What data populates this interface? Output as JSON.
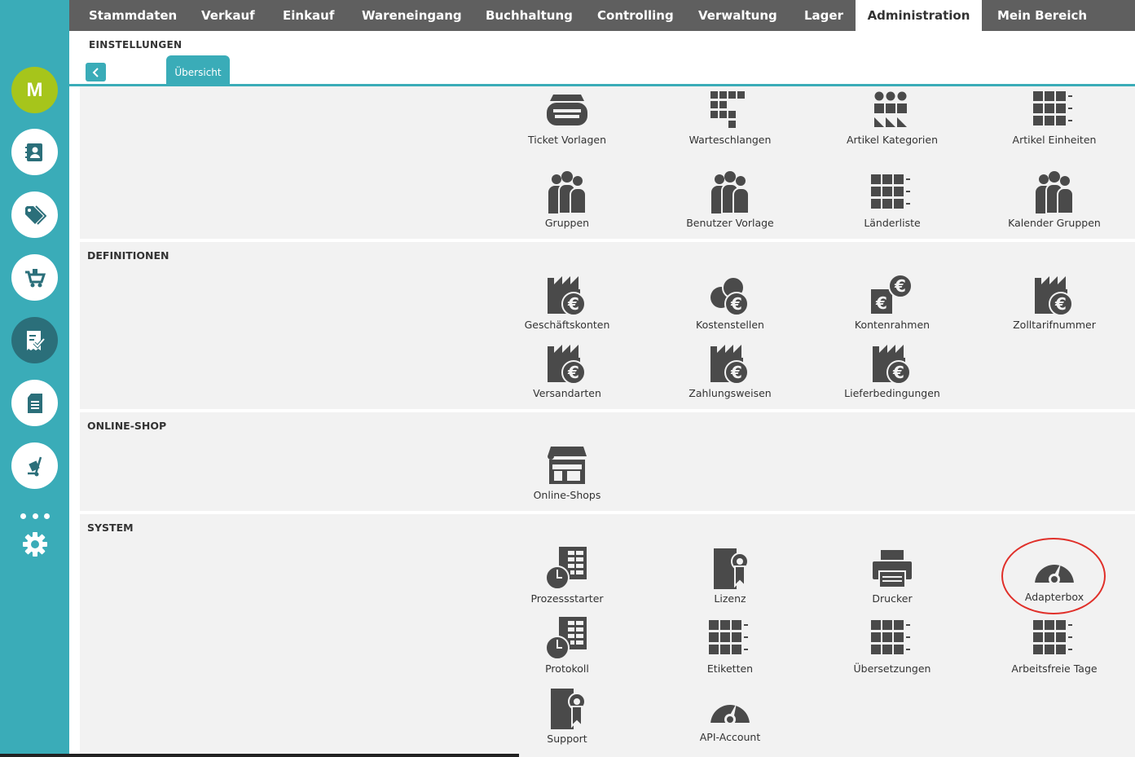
{
  "sidebar": {
    "avatar_letter": "M",
    "items": [
      {
        "icon": "contacts-icon"
      },
      {
        "icon": "tags-icon"
      },
      {
        "icon": "cart-icon"
      },
      {
        "icon": "receipt-check-icon"
      },
      {
        "icon": "document-icon"
      },
      {
        "icon": "hand-truck-icon"
      }
    ],
    "more_icon": "more-dots-icon",
    "settings_icon": "gear-icon"
  },
  "nav": {
    "items": [
      "Stammdaten",
      "Verkauf",
      "Einkauf",
      "Wareneingang",
      "Buchhaltung",
      "Controlling",
      "Verwaltung",
      "Lager",
      "Administration",
      "Mein Bereich"
    ],
    "active": "Administration"
  },
  "header": {
    "title": "EINSTELLUNGEN",
    "tab_overview": "Übersicht"
  },
  "sections": {
    "top": {
      "tiles": [
        {
          "label": "Ticket Vorlagen",
          "icon": "ticket-icon"
        },
        {
          "label": "Warteschlangen",
          "icon": "queue-icon"
        },
        {
          "label": "Artikel Kategorien",
          "icon": "categories-icon"
        },
        {
          "label": "Artikel Einheiten",
          "icon": "grid-list-icon"
        },
        {
          "label": "Gruppen",
          "icon": "group-icon"
        },
        {
          "label": "Benutzer Vorlage",
          "icon": "group-icon"
        },
        {
          "label": "Länderliste",
          "icon": "grid-list-icon"
        },
        {
          "label": "Kalender Gruppen",
          "icon": "group-icon"
        }
      ]
    },
    "definitionen": {
      "title": "DEFINITIONEN",
      "tiles": [
        {
          "label": "Geschäftskonten",
          "icon": "factory-euro-icon"
        },
        {
          "label": "Kostenstellen",
          "icon": "coins-euro-icon"
        },
        {
          "label": "Kontenrahmen",
          "icon": "euro-exchange-icon"
        },
        {
          "label": "Zolltarifnummer",
          "icon": "factory-euro-icon"
        },
        {
          "label": "Versandarten",
          "icon": "factory-euro-icon"
        },
        {
          "label": "Zahlungsweisen",
          "icon": "factory-euro-icon"
        },
        {
          "label": "Lieferbedingungen",
          "icon": "factory-euro-icon"
        }
      ]
    },
    "onlineshop": {
      "title": "ONLINE-SHOP",
      "tiles": [
        {
          "label": "Online-Shops",
          "icon": "shop-icon"
        }
      ]
    },
    "system": {
      "title": "SYSTEM",
      "tiles": [
        {
          "label": "Prozessstarter",
          "icon": "clock-sheet-icon"
        },
        {
          "label": "Lizenz",
          "icon": "license-icon"
        },
        {
          "label": "Drucker",
          "icon": "printer-icon"
        },
        {
          "label": "Adapterbox",
          "icon": "gauge-icon"
        },
        {
          "label": "Protokoll",
          "icon": "clock-sheet-icon"
        },
        {
          "label": "Etiketten",
          "icon": "grid-list-icon"
        },
        {
          "label": "Übersetzungen",
          "icon": "grid-list-icon"
        },
        {
          "label": "Arbeitsfreie Tage",
          "icon": "grid-list-icon"
        },
        {
          "label": "Support",
          "icon": "license-icon"
        },
        {
          "label": "API-Account",
          "icon": "gauge-icon"
        }
      ]
    }
  },
  "colors": {
    "accent": "#3aacb8",
    "nav_bg": "#5f5f5f",
    "avatar": "#a6c51b",
    "icon": "#4a4a4a",
    "highlight": "#e0302a",
    "section_bg": "#f2f2f2"
  }
}
